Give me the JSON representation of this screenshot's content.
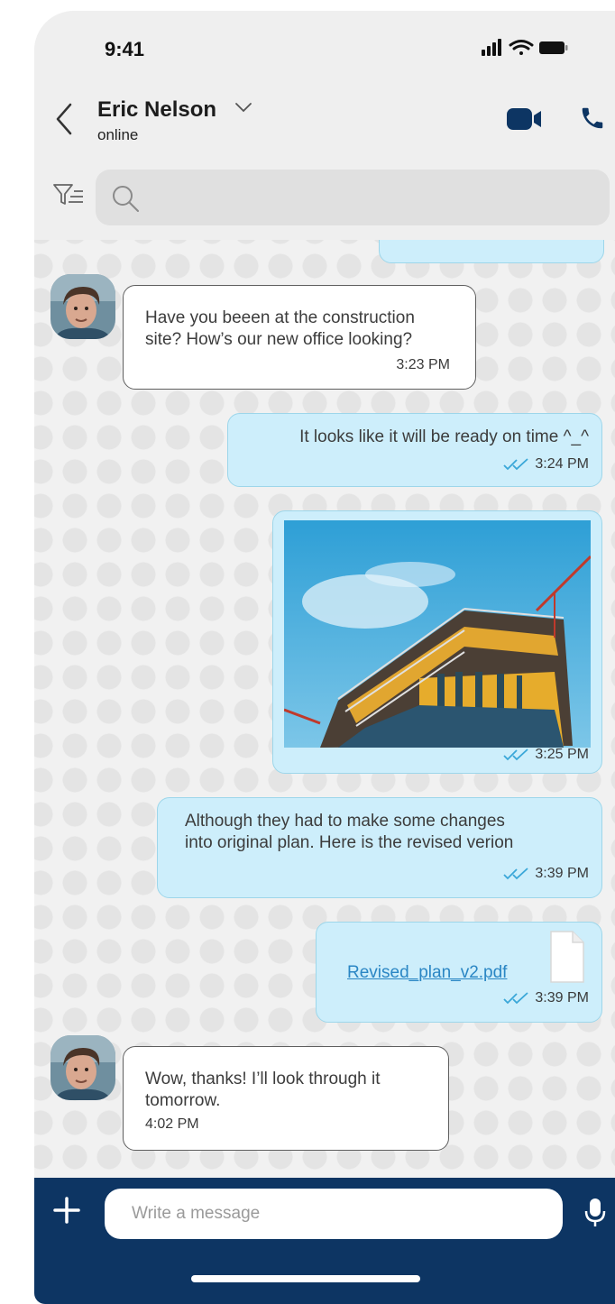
{
  "status_bar": {
    "time": "9:41"
  },
  "header": {
    "contact_name": "Eric Nelson",
    "contact_status": "online"
  },
  "search": {
    "placeholder": ""
  },
  "messages": [
    {
      "direction": "incoming",
      "lines": [
        "Have you beeen at the construction",
        "site? How’s our new office looking?"
      ],
      "time": "3:23 PM"
    },
    {
      "direction": "outgoing",
      "text": "It looks like it will be ready on time ^_^",
      "time": "3:24 PM",
      "status": "read"
    },
    {
      "direction": "outgoing",
      "type": "image",
      "time": "3:25 PM",
      "status": "read"
    },
    {
      "direction": "outgoing",
      "lines": [
        "Although they had to make some changes",
        "into original plan. Here is the revised verion"
      ],
      "time": "3:39 PM",
      "status": "read"
    },
    {
      "direction": "outgoing",
      "type": "file",
      "file_name": "Revised_plan_v2.pdf",
      "time": "3:39 PM",
      "status": "read"
    },
    {
      "direction": "incoming",
      "lines": [
        "Wow, thanks! I’ll look through it",
        "tomorrow."
      ],
      "time": "4:02 PM"
    }
  ],
  "composer": {
    "placeholder": "Write a message"
  },
  "colors": {
    "header_bg": "#efefef",
    "incoming_bubble": "#ffffff",
    "outgoing_bubble": "#cdeefb",
    "footer_bg": "#0d3563",
    "accent": "#0d3563",
    "read_ticks": "#3aa7d8",
    "link": "#2a86c4"
  },
  "icons": [
    "back-chevron-icon",
    "dropdown-chevron-icon",
    "video-call-icon",
    "phone-icon",
    "filter-icon",
    "search-icon",
    "read-receipt-icon",
    "file-icon",
    "plus-icon",
    "microphone-icon"
  ]
}
